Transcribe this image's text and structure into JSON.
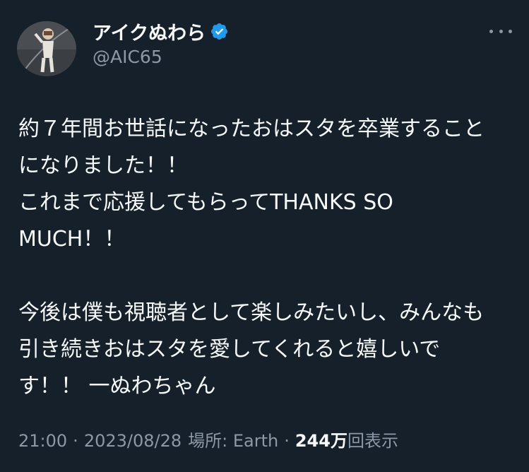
{
  "user": {
    "display_name": "アイクぬわら",
    "handle": "@AIC65",
    "verified": true
  },
  "icons": {
    "avatar": "profile-photo",
    "verified": "verified-badge-icon",
    "more": "more-options-icon"
  },
  "tweet": {
    "paragraph_1": "約７年間お世話になったおはスタを卒業すること\nになりました！！\nこれまで応援してもらってTHANKS SO\nMUCH！！",
    "paragraph_2": "今後は僕も視聴者として楽しみたいし、みんなも\n引き続きおはスタを愛してくれると嬉しいで\nす！！ 一ぬわちゃん"
  },
  "meta": {
    "time": "21:00",
    "date": "2023/08/28",
    "location": "場所: Earth",
    "views_count": "244",
    "views_unit": "万",
    "views_label": "回表示",
    "separator": "·"
  },
  "colors": {
    "background": "#15202b",
    "text_primary": "#f7f9f9",
    "text_secondary": "#8b98a5",
    "verified_blue": "#1d9bf0"
  }
}
